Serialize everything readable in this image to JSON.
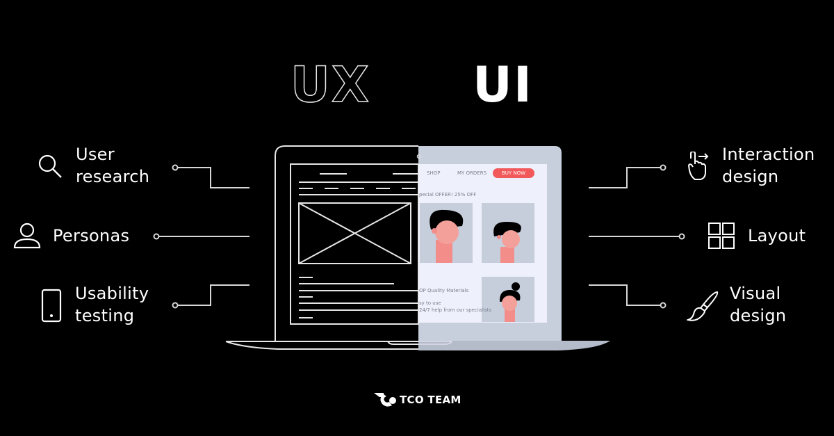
{
  "headings": {
    "left": "UX",
    "right": "UI"
  },
  "ux_items": [
    {
      "icon": "search-icon",
      "line1": "User",
      "line2": "research"
    },
    {
      "icon": "person-icon",
      "line1": "Personas"
    },
    {
      "icon": "smartphone-icon",
      "line1": "Usability",
      "line2": "testing"
    }
  ],
  "ui_items": [
    {
      "icon": "hand-swipe-icon",
      "line1": "Interaction",
      "line2": "design"
    },
    {
      "icon": "grid-layout-icon",
      "line1": "Layout"
    },
    {
      "icon": "paintbrush-icon",
      "line1": "Visual",
      "line2": "design"
    }
  ],
  "mockup": {
    "nav": {
      "shop": "SHOP",
      "orders": "MY ORDERS",
      "buy": "BUY NOW"
    },
    "offer": "pecial OFFER! 25% OFF",
    "features": [
      "OP Quality Materials",
      "sy to use",
      "24/7 help from our specialists"
    ]
  },
  "colors": {
    "background": "#000000",
    "ui_screen": "#eef0fb",
    "ui_frame": "#c7cfdd",
    "accent": "#f2595a",
    "skin": "#f4a09a",
    "hair": "#000000"
  },
  "brand": {
    "name": "TCO TEAM"
  }
}
